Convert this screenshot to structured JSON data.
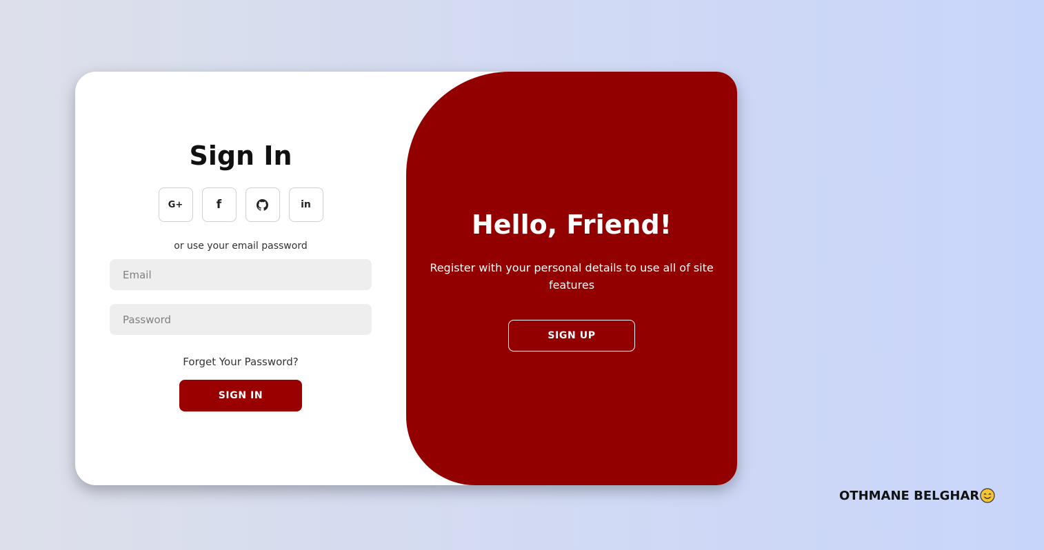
{
  "signin": {
    "title": "Sign In",
    "social": [
      {
        "label": "G+",
        "icon": "google-plus-icon"
      },
      {
        "label": "f",
        "icon": "facebook-icon"
      },
      {
        "label": "",
        "icon": "github-icon"
      },
      {
        "label": "in",
        "icon": "linkedin-icon"
      }
    ],
    "alt_text": "or use your email password",
    "email_placeholder": "Email",
    "email_value": "",
    "password_placeholder": "Password",
    "password_value": "",
    "forgot_label": "Forget Your Password?",
    "submit_label": "SIGN IN"
  },
  "toggle": {
    "title": "Hello, Friend!",
    "text": "Register with your personal details to use all of site features",
    "button_label": "SIGN UP"
  },
  "credit": {
    "text": "OTHMANE BELGHAR",
    "emoji_icon": "smiling-face-icon"
  },
  "colors": {
    "accent": "#990000",
    "panel": "#930000",
    "field_bg": "#eeeeee",
    "background_start": "#dde0ea",
    "background_end": "#c8d5fb"
  }
}
